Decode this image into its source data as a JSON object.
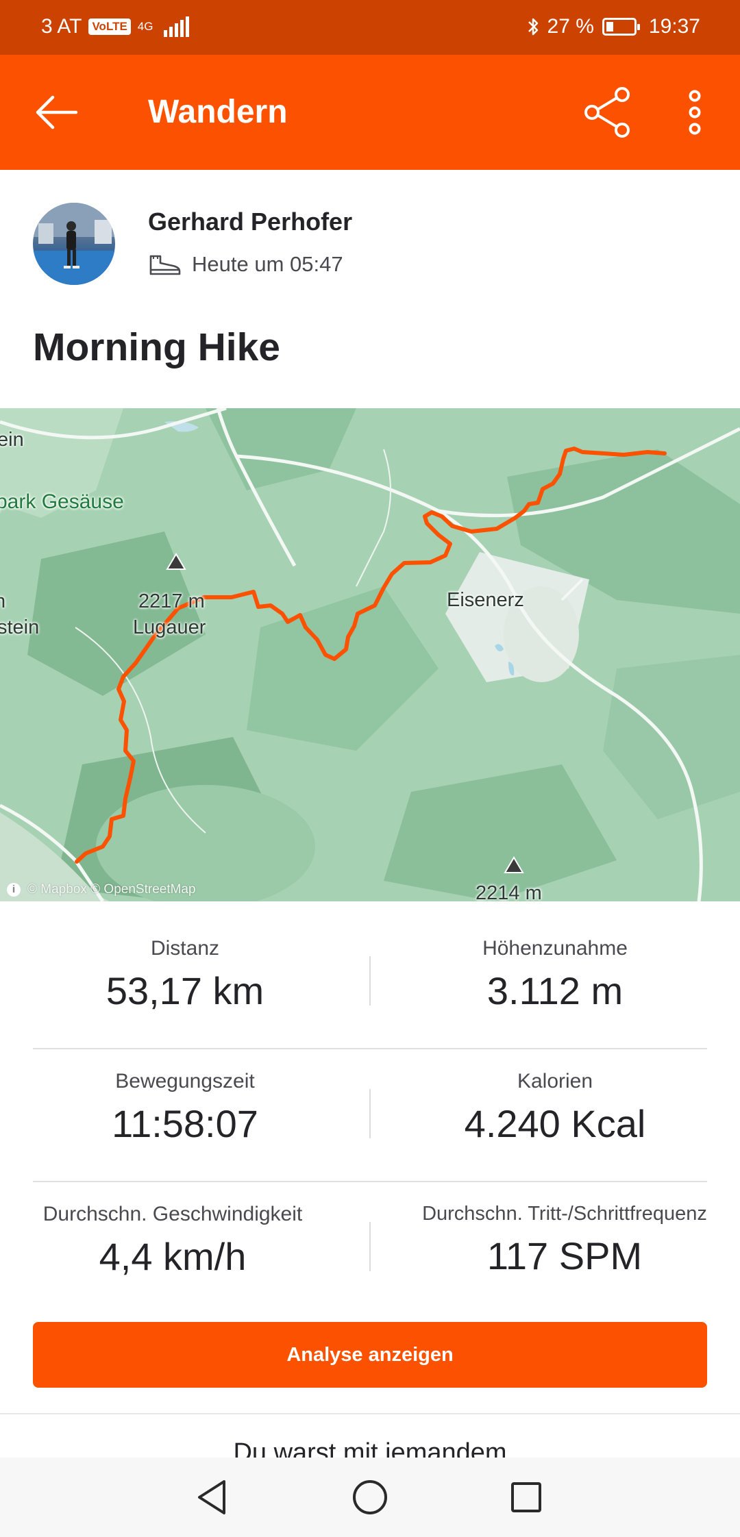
{
  "status_bar": {
    "carrier": "3 AT",
    "volte": "VoLTE",
    "network": "4G",
    "battery_percent": "27 %",
    "battery_level": 0.27,
    "time": "19:37"
  },
  "app_bar": {
    "title": "Wandern",
    "icons": [
      "back-arrow-icon",
      "share-icon",
      "more-vertical-icon"
    ]
  },
  "athlete": {
    "name": "Gerhard Perhofer",
    "time": "Heute um 05:47",
    "sport_icon": "hiking-boot-icon"
  },
  "activity": {
    "title": "Morning Hike"
  },
  "map": {
    "labels": {
      "ein": "ein",
      "park": "park Gesäuse",
      "peak1": "2217 m",
      "lugauer": "Lugauer",
      "n": "n",
      "stein": "stein",
      "eisenerz": "Eisenerz",
      "peak2": "2214 m"
    },
    "attribution": "© Mapbox © OpenStreetMap",
    "route_color": "#fc5200"
  },
  "stats": [
    {
      "label": "Distanz",
      "value": "53,17 km"
    },
    {
      "label": "Höhenzunahme",
      "value": "3.112 m"
    },
    {
      "label": "Bewegungszeit",
      "value": "11:58:07"
    },
    {
      "label": "Kalorien",
      "value": "4.240 Kcal"
    },
    {
      "label": "Durchschn. Geschwindigkeit",
      "value": "4,4 km/h"
    },
    {
      "label": "Durchschn. Tritt-/Schrittfrequenz",
      "value": "117 SPM"
    }
  ],
  "actions": {
    "analysis_button": "Analyse anzeigen"
  },
  "section": {
    "with_someone": "Du warst mit jemandem"
  },
  "nav_bar": {
    "icons": [
      "nav-back-icon",
      "nav-home-icon",
      "nav-recents-icon"
    ]
  },
  "colors": {
    "accent": "#fc5200",
    "status_bar": "#cc4200"
  }
}
